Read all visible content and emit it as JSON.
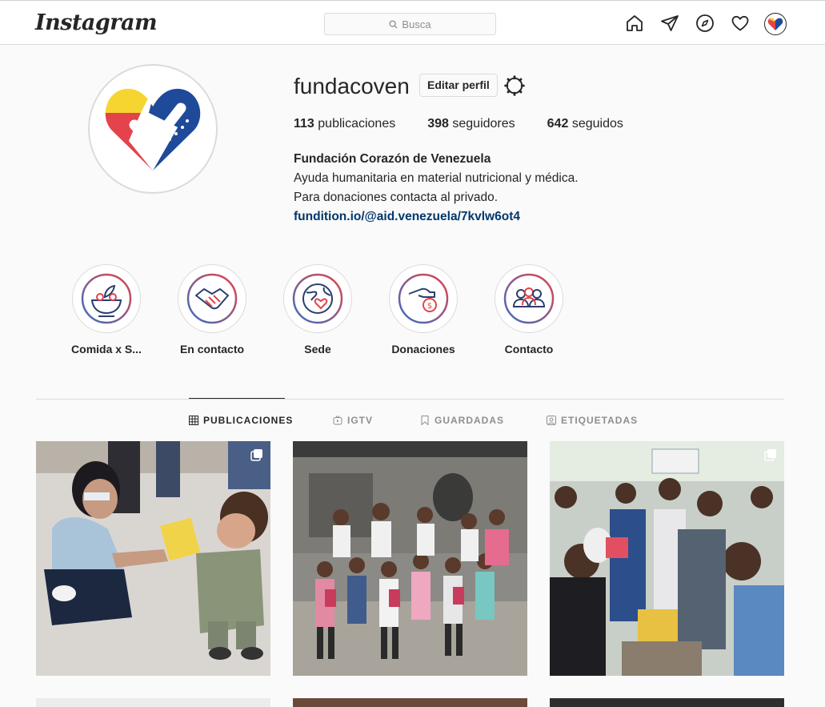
{
  "header": {
    "logo": "Instagram",
    "search_placeholder": "Busca"
  },
  "profile": {
    "username": "fundacoven",
    "edit_label": "Editar perfil",
    "stats": [
      {
        "count": "113",
        "label": "publicaciones"
      },
      {
        "count": "398",
        "label": "seguidores"
      },
      {
        "count": "642",
        "label": "seguidos"
      }
    ],
    "full_name": "Fundación Corazón de Venezuela",
    "bio_lines": [
      "Ayuda humanitaria en material nutricional y médica.",
      "Para donaciones contacta al privado."
    ],
    "link": "fundition.io/@aid.venezuela/7kvlw6ot4"
  },
  "highlights": [
    {
      "label": "Comida x S...",
      "icon": "food-bowl-icon"
    },
    {
      "label": "En contacto",
      "icon": "handshake-icon"
    },
    {
      "label": "Sede",
      "icon": "globe-heart-icon"
    },
    {
      "label": "Donaciones",
      "icon": "donation-hand-icon"
    },
    {
      "label": "Contacto",
      "icon": "group-people-icon"
    }
  ],
  "tabs": [
    {
      "label": "PUBLICACIONES",
      "icon": "grid-icon",
      "active": true
    },
    {
      "label": "IGTV",
      "icon": "tv-icon",
      "active": false
    },
    {
      "label": "GUARDADAS",
      "icon": "bookmark-icon",
      "active": false
    },
    {
      "label": "ETIQUETADAS",
      "icon": "tag-person-icon",
      "active": false
    }
  ],
  "colors": {
    "text": "#262626",
    "muted": "#8e8e8e",
    "border": "#dbdbdb",
    "link": "#00376b",
    "brand_yellow": "#f7d531",
    "brand_blue": "#1f4a9a",
    "brand_red": "#e4434b"
  }
}
